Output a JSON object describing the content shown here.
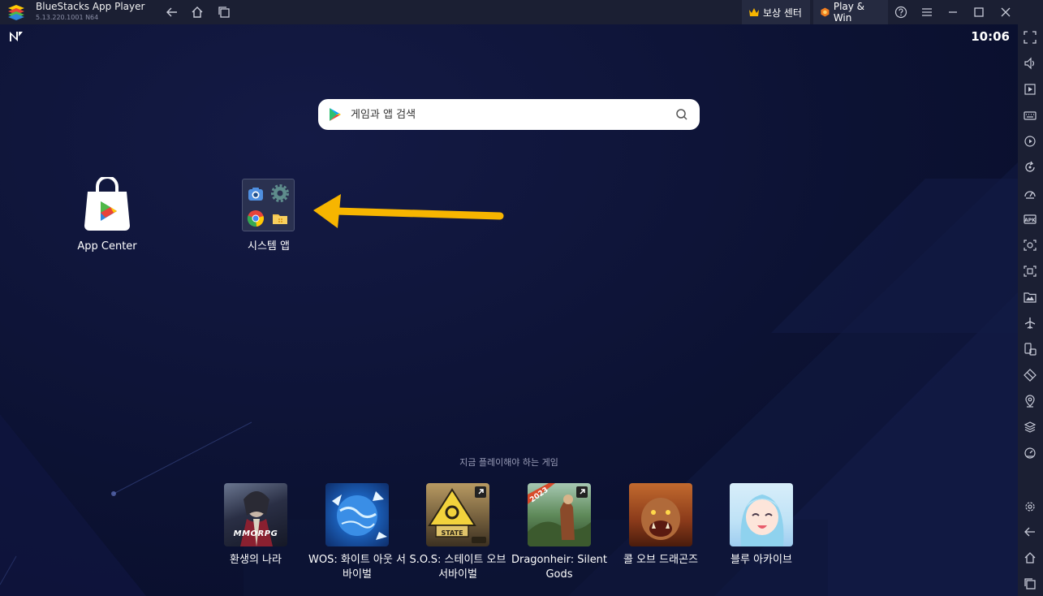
{
  "titlebar": {
    "app_name": "BlueStacks App Player",
    "version": "5.13.220.1001  N64",
    "reward_label": "보상 센터",
    "playwin_label": "Play & Win"
  },
  "status": {
    "time": "10:06"
  },
  "search": {
    "placeholder": "게임과 앱 검색"
  },
  "desktop": {
    "app_center_label": "App Center",
    "system_apps_label": "시스템 앱"
  },
  "recommend": {
    "title": "지금 플레이해야 하는 게임",
    "games": [
      {
        "name": "환생의 나라",
        "badge": "MMORPG"
      },
      {
        "name": "WOS: 화이트 아웃 서바이벌"
      },
      {
        "name": "S.O.S: 스테이트 오브 서바이벌",
        "badge": "STATE"
      },
      {
        "name": "Dragonheir: Silent Gods",
        "badge": "2023"
      },
      {
        "name": "콜 오브 드래곤즈"
      },
      {
        "name": "블루 아카이브"
      }
    ]
  },
  "colors": {
    "accent_arrow": "#f7b500",
    "titlebar_bg": "#1b1f33",
    "screen_bg": "#0c1233"
  }
}
